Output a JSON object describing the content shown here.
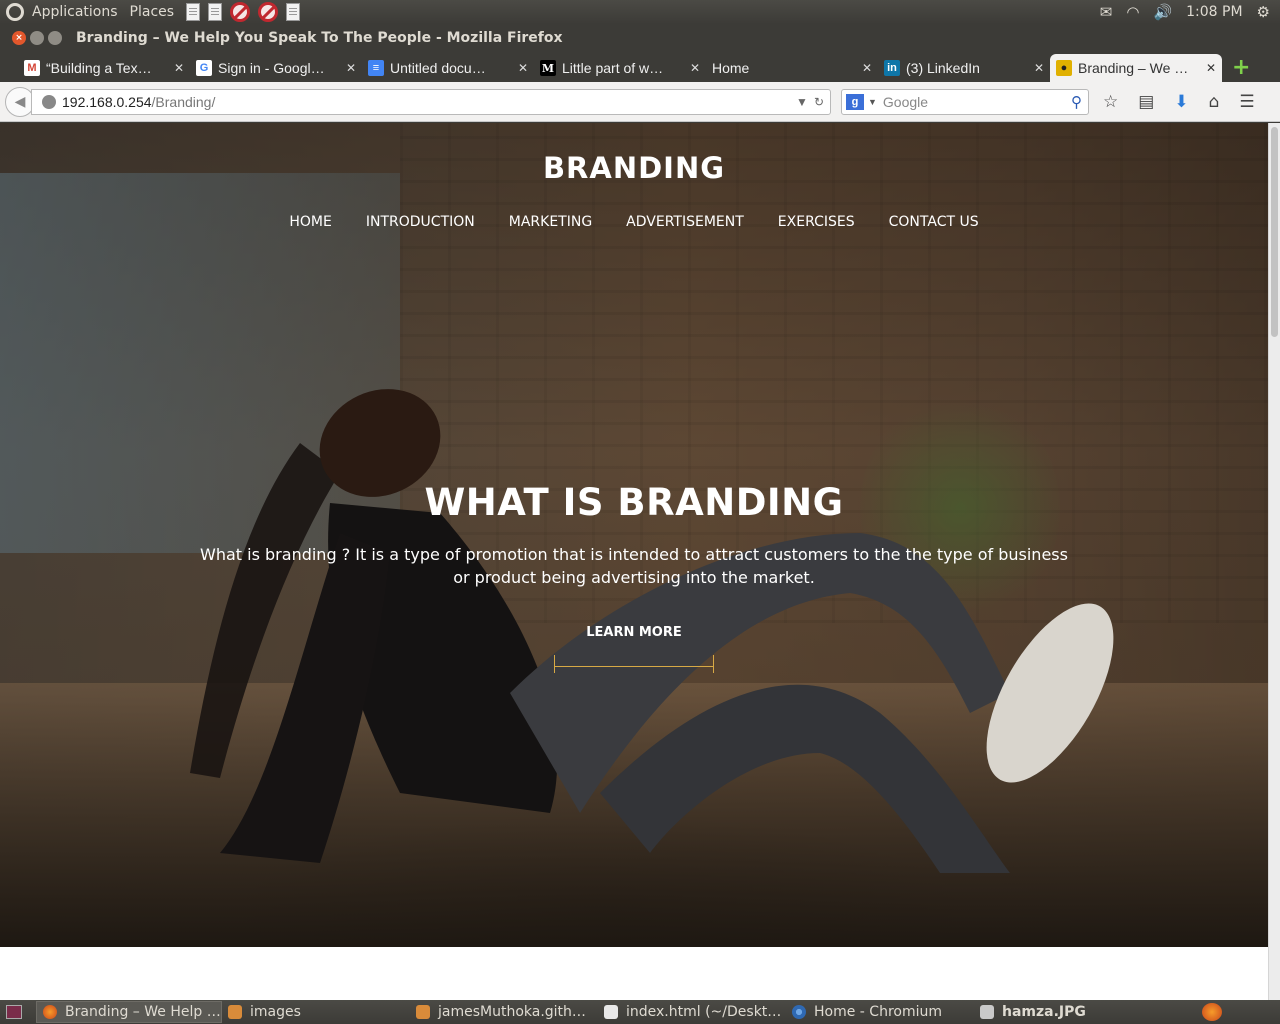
{
  "top_panel": {
    "menus": [
      "Applications",
      "Places"
    ],
    "time": "1:08 PM",
    "tray_icons": [
      "mail-icon",
      "wifi-icon",
      "volume-icon",
      "gear-icon"
    ]
  },
  "window": {
    "title": "Branding – We Help You Speak To The People - Mozilla Firefox"
  },
  "tabs": [
    {
      "label": "“Building a Tex…",
      "favicon": "gmail-icon",
      "active": false
    },
    {
      "label": "Sign in - Googl…",
      "favicon": "google-icon",
      "active": false
    },
    {
      "label": "Untitled docu…",
      "favicon": "docs-icon",
      "active": false
    },
    {
      "label": "Little part of w…",
      "favicon": "medium-icon",
      "active": false
    },
    {
      "label": "Home",
      "favicon": "",
      "active": false
    },
    {
      "label": "(3) LinkedIn",
      "favicon": "linkedin-icon",
      "active": false
    },
    {
      "label": "Branding – We …",
      "favicon": "branding-icon",
      "active": true
    }
  ],
  "navbar": {
    "url_host": "192.168.0.254",
    "url_path": "/Branding/",
    "search_placeholder": "Google"
  },
  "site": {
    "logo": "BRANDING",
    "nav": [
      "HOME",
      "INTRODUCTION",
      "MARKETING",
      "ADVERTISEMENT",
      "EXERCISES",
      "CONTACT US"
    ],
    "hero_heading": "WHAT IS BRANDING",
    "hero_body": "What is branding ? It is a type of promotion that is intended to attract customers to the the type of business or product being advertising into the market.",
    "cta": "LEARN MORE",
    "accent_color": "#d7a945"
  },
  "taskbar": {
    "tasks": [
      {
        "label": "Branding – We Help …",
        "icon": "firefox-icon",
        "active": true
      },
      {
        "label": "images",
        "icon": "folder-icon",
        "active": false
      },
      {
        "label": "jamesMuthoka.gith…",
        "icon": "folder-icon",
        "active": false
      },
      {
        "label": "index.html (~/Deskt…",
        "icon": "editor-icon",
        "active": false
      },
      {
        "label": "Home - Chromium",
        "icon": "chromium-icon",
        "active": false
      },
      {
        "label": "hamza.JPG",
        "icon": "image-icon",
        "active": false
      }
    ]
  }
}
